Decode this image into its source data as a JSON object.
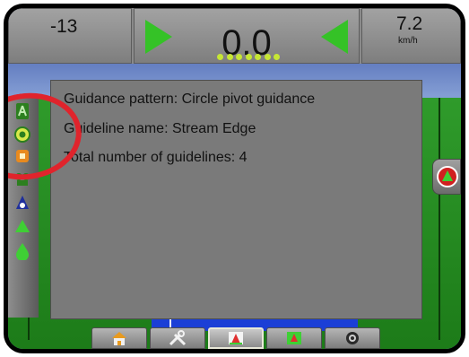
{
  "top_bar": {
    "cross_track": "-13",
    "distance": "0.0",
    "speed_value": "7.2",
    "speed_unit": "km/h"
  },
  "info_popup": {
    "lines": [
      "Guidance pattern: Circle pivot guidance",
      "Guideline name: Stream Edge",
      "Total number of guidelines: 4"
    ]
  },
  "left_toolbar": {
    "icons": [
      "guideline-a-icon",
      "circle-pivot-icon",
      "marker-icon",
      "boundary-icon",
      "vehicle-view-icon",
      "arrow-up-icon",
      "water-drop-icon"
    ]
  },
  "bottom_tabs": {
    "tabs": [
      "home-icon",
      "tools-icon",
      "guidance-icon",
      "map-icon",
      "camera-icon"
    ],
    "active_index": 2
  },
  "colors": {
    "accent_green": "#35c227",
    "annotation_red": "#e0242c",
    "panel_gray": "#7a7a7a"
  }
}
